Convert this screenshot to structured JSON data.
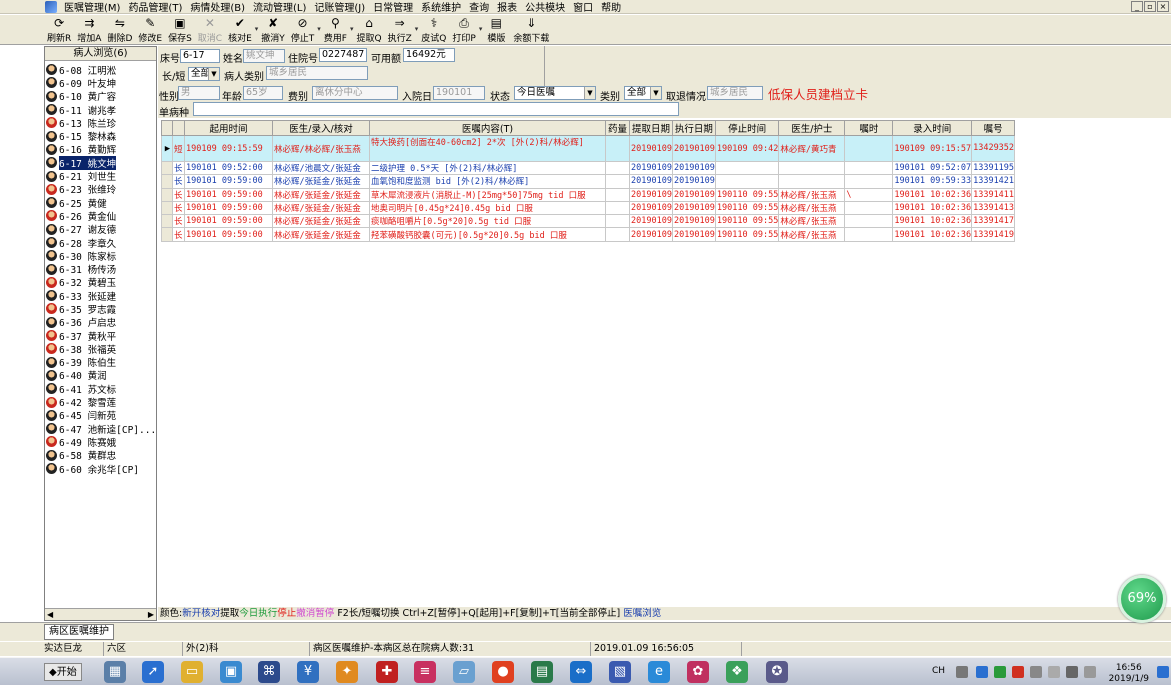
{
  "menu": {
    "items": [
      "医嘱管理(M)",
      "药品管理(T)",
      "病情处理(B)",
      "流动管理(L)",
      "记账管理(J)",
      "日常管理",
      "系统维护",
      "查询",
      "报表",
      "公共模块",
      "窗口",
      "帮助"
    ],
    "window_controls": [
      "_",
      "▫",
      "×"
    ]
  },
  "toolbar": {
    "buttons": [
      {
        "label": "刷新R",
        "icon": "⟳",
        "enabled": true
      },
      {
        "label": "增加A",
        "icon": "⇉",
        "enabled": true
      },
      {
        "label": "删除D",
        "icon": "⇋",
        "enabled": true
      },
      {
        "label": "修改E",
        "icon": "✎",
        "enabled": true
      },
      {
        "label": "保存S",
        "icon": "▣",
        "enabled": true
      },
      {
        "label": "取消C",
        "icon": "✕",
        "enabled": false
      },
      {
        "label": "核对E",
        "icon": "✔",
        "enabled": true
      },
      {
        "label": "撤消Y",
        "icon": "✘",
        "enabled": true
      },
      {
        "label": "停止T",
        "icon": "⊘",
        "enabled": true
      },
      {
        "label": "费用F",
        "icon": "⚲",
        "enabled": true
      },
      {
        "label": "提取Q",
        "icon": "⌂",
        "enabled": true
      },
      {
        "label": "执行Z",
        "icon": "⇒",
        "enabled": true
      },
      {
        "label": "皮试Q",
        "icon": "⚕",
        "enabled": true
      },
      {
        "label": "打印P",
        "icon": "⎙",
        "enabled": true
      },
      {
        "label": "模版",
        "icon": "▤",
        "enabled": true
      },
      {
        "label": "余额下载",
        "icon": "⇓",
        "enabled": true
      }
    ]
  },
  "patient_panel": {
    "header": "病人浏览(6)",
    "selected_index": 9,
    "patients": [
      {
        "bed": "6-08",
        "name": "江明淞",
        "gender": "m"
      },
      {
        "bed": "6-09",
        "name": "叶友坤",
        "gender": "m"
      },
      {
        "bed": "6-10",
        "name": "黄广容",
        "gender": "m"
      },
      {
        "bed": "6-11",
        "name": "谢兆孝",
        "gender": "m"
      },
      {
        "bed": "6-13",
        "name": "陈兰珍",
        "gender": "f"
      },
      {
        "bed": "6-15",
        "name": "黎林森",
        "gender": "m"
      },
      {
        "bed": "6-16",
        "name": "黄勤辉",
        "gender": "m"
      },
      {
        "bed": "6-17",
        "name": "姚文坤",
        "gender": "m"
      },
      {
        "bed": "6-21",
        "name": "刘世生",
        "gender": "m"
      },
      {
        "bed": "6-23",
        "name": "张维玲",
        "gender": "f"
      },
      {
        "bed": "6-25",
        "name": "黄健",
        "gender": "m"
      },
      {
        "bed": "6-26",
        "name": "黄金仙",
        "gender": "f"
      },
      {
        "bed": "6-27",
        "name": "谢友德",
        "gender": "m"
      },
      {
        "bed": "6-28",
        "name": "李章久",
        "gender": "m"
      },
      {
        "bed": "6-30",
        "name": "陈家标",
        "gender": "m"
      },
      {
        "bed": "6-31",
        "name": "杨传汤",
        "gender": "m"
      },
      {
        "bed": "6-32",
        "name": "黄碧玉",
        "gender": "f"
      },
      {
        "bed": "6-33",
        "name": "张延建",
        "gender": "m"
      },
      {
        "bed": "6-35",
        "name": "罗志霞",
        "gender": "f"
      },
      {
        "bed": "6-36",
        "name": "卢启忠",
        "gender": "m"
      },
      {
        "bed": "6-37",
        "name": "黄秋平",
        "gender": "f"
      },
      {
        "bed": "6-38",
        "name": "张福英",
        "gender": "f"
      },
      {
        "bed": "6-39",
        "name": "陈伯生",
        "gender": "m"
      },
      {
        "bed": "6-40",
        "name": "黄润",
        "gender": "m"
      },
      {
        "bed": "6-41",
        "name": "苏文标",
        "gender": "m"
      },
      {
        "bed": "6-42",
        "name": "黎雪莲",
        "gender": "f"
      },
      {
        "bed": "6-45",
        "name": "闫新苑",
        "gender": "m"
      },
      {
        "bed": "6-47",
        "name": "池新逵[CP]...",
        "gender": "m"
      },
      {
        "bed": "6-49",
        "name": "陈赛娥",
        "gender": "f"
      },
      {
        "bed": "6-58",
        "name": "黄群忠",
        "gender": "m"
      },
      {
        "bed": "6-60",
        "name": "余兆华[CP]",
        "gender": "m"
      }
    ]
  },
  "info_form": {
    "bed_label": "床号",
    "bed_value": "6-17",
    "name_label": "姓名",
    "name_value": "姚文坤",
    "admission_no_label": "住院号",
    "admission_no_value": "0227487",
    "balance_label": "可用额",
    "balance_value": "16492元",
    "long_short_label": "长/短",
    "long_short_value": "全部",
    "patient_type_label": "病人类别",
    "patient_type_value": "城乡居民",
    "gender_label": "性别",
    "gender_value": "男",
    "age_label": "年龄",
    "age_value": "65岁",
    "fee_type_label": "费别",
    "fee_type_value": "离休分中心",
    "admit_date_label": "入院日",
    "admit_date_value": "190101",
    "status_label": "状态",
    "status_value": "今日医嘱",
    "category_label": "类别",
    "category_value": "全部",
    "withdraw_label": "取退情况",
    "withdraw_value": "城乡居民",
    "disease_label": "单病种",
    "disease_value": "",
    "alert": "低保人员建档立卡"
  },
  "orders": {
    "columns": [
      "",
      "",
      "起用时间",
      "医生/录入/核对",
      "医嘱内容(T)",
      "药量",
      "提取日期",
      "执行日期",
      "停止时间",
      "医生/护士",
      "嘱时",
      "录入时间",
      "嘱号"
    ],
    "rows": [
      {
        "type": "短",
        "start": "190109 09:15:59",
        "doctor": "林必辉/林必辉/张玉燕",
        "content": "特大换药[创面在40-60cm2] 2*次 [外(2)科/林必辉]",
        "dose": "",
        "extract": "20190109",
        "exec": "20190109",
        "stop": "190109 09:42",
        "nurse": "林必辉/黄巧青",
        "time": "",
        "entry": "190109 09:15:57",
        "no": "13429352",
        "color": "red",
        "selected": true
      },
      {
        "type": "长",
        "start": "190101 09:52:00",
        "doctor": "林必辉/池晨文/张延金",
        "content": "二级护理 0.5*天 [外(2)科/林必辉]",
        "dose": "",
        "extract": "20190109",
        "exec": "20190109",
        "stop": "",
        "nurse": "",
        "time": "",
        "entry": "190101 09:52:07",
        "no": "13391195",
        "color": "blue",
        "selected": false
      },
      {
        "type": "长",
        "start": "190101 09:59:00",
        "doctor": "林必辉/张延金/张延金",
        "content": "血氧饱和度监测 bid [外(2)科/林必辉]",
        "dose": "",
        "extract": "20190109",
        "exec": "20190109",
        "stop": "",
        "nurse": "",
        "time": "",
        "entry": "190101 09:59:33",
        "no": "13391421",
        "color": "blue",
        "selected": false
      },
      {
        "type": "长",
        "start": "190101 09:59:00",
        "doctor": "林必辉/张延金/张延金",
        "content": "草木犀流浸液片(消脱止-M)[25mg*50]75mg tid 口服",
        "dose": "",
        "extract": "20190109",
        "exec": "20190109",
        "stop": "190110 09:55",
        "nurse": "林必辉/张玉燕",
        "time": "\\",
        "entry": "190101 10:02:36",
        "no": "13391411",
        "color": "red",
        "selected": false
      },
      {
        "type": "长",
        "start": "190101 09:59:00",
        "doctor": "林必辉/张延金/张延金",
        "content": "地奥司明片[0.45g*24]0.45g bid 口服",
        "dose": "",
        "extract": "20190109",
        "exec": "20190109",
        "stop": "190110 09:55",
        "nurse": "林必辉/张玉燕",
        "time": "",
        "entry": "190101 10:02:36",
        "no": "13391413",
        "color": "red",
        "selected": false
      },
      {
        "type": "长",
        "start": "190101 09:59:00",
        "doctor": "林必辉/张延金/张延金",
        "content": "痰咖酪咀嚼片[0.5g*20]0.5g tid 口服",
        "dose": "",
        "extract": "20190109",
        "exec": "20190109",
        "stop": "190110 09:55",
        "nurse": "林必辉/张玉燕",
        "time": "",
        "entry": "190101 10:02:36",
        "no": "13391417",
        "color": "red",
        "selected": false
      },
      {
        "type": "长",
        "start": "190101 09:59:00",
        "doctor": "林必辉/张延金/张延金",
        "content": "羟苯磺酸钙胶囊(可元)[0.5g*20]0.5g bid 口服",
        "dose": "",
        "extract": "20190109",
        "exec": "20190109",
        "stop": "190110 09:55",
        "nurse": "林必辉/张玉燕",
        "time": "",
        "entry": "190101 10:02:36",
        "no": "13391419",
        "color": "red",
        "selected": false
      }
    ]
  },
  "legend": {
    "parts": [
      {
        "text": "颜色:",
        "color": "#000000"
      },
      {
        "text": "新开",
        "color": "#1a3fae"
      },
      {
        "text": "核对",
        "color": "#1a3fae"
      },
      {
        "text": "提取",
        "color": "#000000"
      },
      {
        "text": "今日执行",
        "color": "#1a9a3a"
      },
      {
        "text": "停止",
        "color": "#e0201a"
      },
      {
        "text": "撤消",
        "color": "#d04ad0"
      },
      {
        "text": "暂停",
        "color": "#d04ad0"
      },
      {
        "text": " F2长/短嘱切换 Ctrl+Z[暂停]+Q[起用]+F[复制]+T[当前全部停止] ",
        "color": "#000000"
      },
      {
        "text": "医嘱浏览",
        "color": "#1a3fae"
      }
    ]
  },
  "tabs": {
    "active": "病区医嘱维护"
  },
  "status_bar": {
    "user": "实达巨龙",
    "ward": "六区",
    "dept": "外(2)科",
    "message": "病区医嘱维护-本病区总在院病人数:31",
    "datetime": "2019.01.09 16:56:05"
  },
  "badge": {
    "percent": "69%"
  },
  "taskbar": {
    "start_label": "开始",
    "clock_time": "16:56",
    "clock_date": "2019/1/9",
    "ime_label": "CH"
  }
}
